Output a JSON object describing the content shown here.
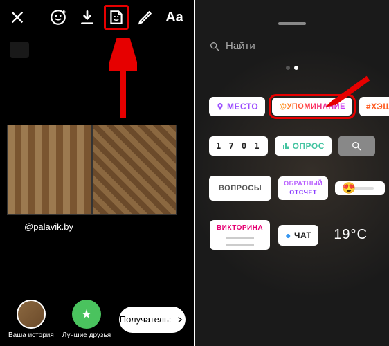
{
  "left": {
    "toolbar": {
      "icons": [
        "face-filter-icon",
        "download-icon",
        "sticker-icon",
        "draw-icon",
        "text-icon"
      ],
      "text_tool_label": "Aa"
    },
    "mention": "@palavik.by",
    "bottom": {
      "your_story": "Ваша история",
      "best_friends": "Лучшие друзья",
      "recipient": "Получатель:",
      "friends_star": "★"
    }
  },
  "right": {
    "search_placeholder": "Найти",
    "stickers": {
      "location": "МЕСТО",
      "mention": "@УПОМИНАНИЕ",
      "hashtag": "#ХЭШТЕГ",
      "time": "1 7 0 1",
      "poll": "ОПРОС",
      "questions": "ВОПРОСЫ",
      "countdown_top": "ОБРАТНЫЙ",
      "countdown_bottom": "ОТСЧЕТ",
      "emoji": "😍",
      "quiz_title": "ВИКТОРИНА",
      "chat": "ЧАТ",
      "temperature": "19°C"
    }
  },
  "annotations": {
    "highlight_color": "#e60000"
  }
}
